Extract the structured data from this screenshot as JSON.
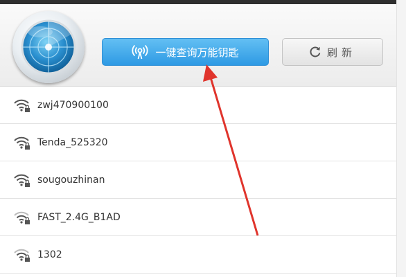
{
  "header": {
    "key_button": {
      "label": "一键查询万能钥匙",
      "icon": "wifi-signal-icon"
    },
    "refresh_button": {
      "label": "刷新",
      "icon": "refresh-icon"
    },
    "logo_icon": "radar-globe-icon"
  },
  "networks": [
    {
      "ssid": "zwj470900100",
      "signal": 3,
      "locked": true
    },
    {
      "ssid": "Tenda_525320",
      "signal": 3,
      "locked": true
    },
    {
      "ssid": "sougouzhinan",
      "signal": 3,
      "locked": true
    },
    {
      "ssid": "FAST_2.4G_B1AD",
      "signal": 2,
      "locked": true
    },
    {
      "ssid": "1302",
      "signal": 2,
      "locked": true
    }
  ],
  "colors": {
    "primary_button": "#3aa7ec",
    "annotation_arrow": "#e0342c",
    "text": "#333333"
  }
}
